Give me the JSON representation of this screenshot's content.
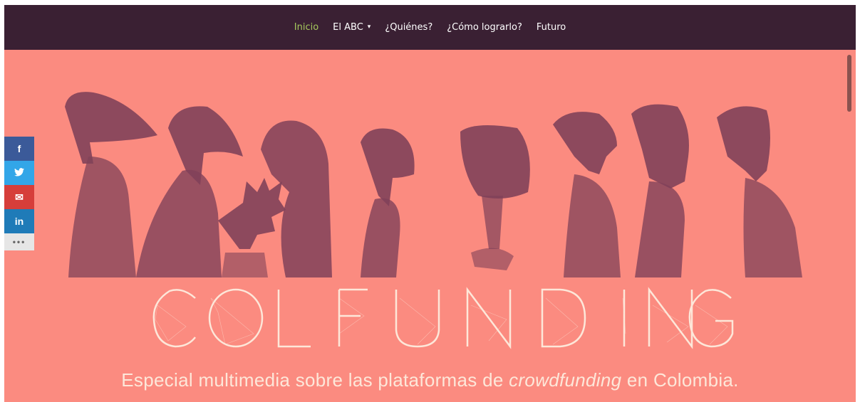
{
  "nav": {
    "items": [
      {
        "label": "Inicio",
        "active": true
      },
      {
        "label": "El ABC",
        "dropdown": true
      },
      {
        "label": "¿Quiénes?"
      },
      {
        "label": "¿Cómo lograrlo?"
      },
      {
        "label": "Futuro"
      }
    ],
    "chevron": "⌄"
  },
  "hero": {
    "title": "COLFUNDING",
    "subtitle_before": "Especial multimedia sobre las plataformas de ",
    "subtitle_em": "crowdfunding",
    "subtitle_after": " en Colombia."
  },
  "share": {
    "facebook": "f",
    "twitter": "t",
    "mail": "✉",
    "linkedin": "in",
    "more": "•••",
    "icons": [
      "facebook-icon",
      "twitter-icon",
      "mail-icon",
      "linkedin-icon",
      "more-icon"
    ]
  },
  "colors": {
    "nav_bg": "#3a2033",
    "hero_bg": "#fb8b80",
    "active": "#a6c95d",
    "figure": "#6b3552"
  }
}
